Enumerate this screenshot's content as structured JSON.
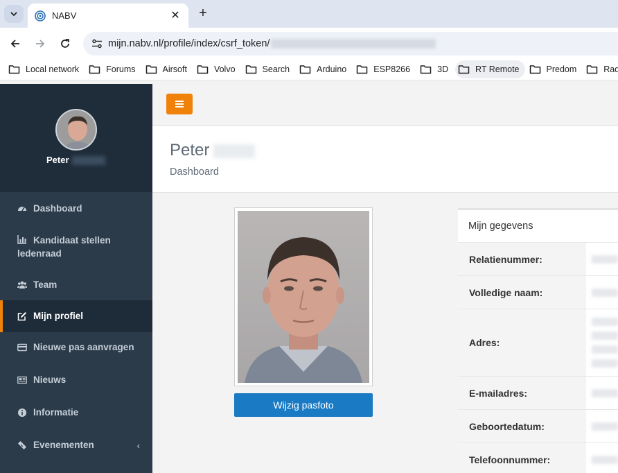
{
  "browser": {
    "tab_title": "NABV",
    "url_text": "mijn.nabv.nl/profile/index/csrf_token/",
    "bookmarks": [
      "Local network",
      "Forums",
      "Airsoft",
      "Volvo",
      "Search",
      "Arduino",
      "ESP8266",
      "3D",
      "RT Remote",
      "Predom",
      "Rad"
    ]
  },
  "sidebar": {
    "user_first_name": "Peter",
    "menu": [
      {
        "label": "Dashboard",
        "icon": "dashboard-icon"
      },
      {
        "label": "Kandidaat stellen ledenraad",
        "icon": "bar-chart-icon"
      },
      {
        "label": "Team",
        "icon": "users-icon"
      },
      {
        "label": "Mijn profiel",
        "icon": "edit-icon"
      },
      {
        "label": "Nieuwe pas aanvragen",
        "icon": "credit-card-icon"
      },
      {
        "label": "Nieuws",
        "icon": "newspaper-icon"
      },
      {
        "label": "Informatie",
        "icon": "info-icon"
      },
      {
        "label": "Evenementen",
        "icon": "ticket-icon"
      }
    ]
  },
  "header": {
    "title_first_name": "Peter",
    "breadcrumb": "Dashboard"
  },
  "profile": {
    "change_photo_label": "Wijzig pasfoto"
  },
  "details": {
    "title": "Mijn gegevens",
    "rows": [
      {
        "label": "Relatienummer:"
      },
      {
        "label": "Volledige naam:"
      },
      {
        "label": "Adres:"
      },
      {
        "label": "E-mailadres:"
      },
      {
        "label": "Geboortedatum:"
      },
      {
        "label": "Telefoonnummer:"
      }
    ]
  },
  "colors": {
    "accent": "#f0820a",
    "sidebar": "#2c3b4a",
    "primary_button": "#1a7bc4"
  }
}
